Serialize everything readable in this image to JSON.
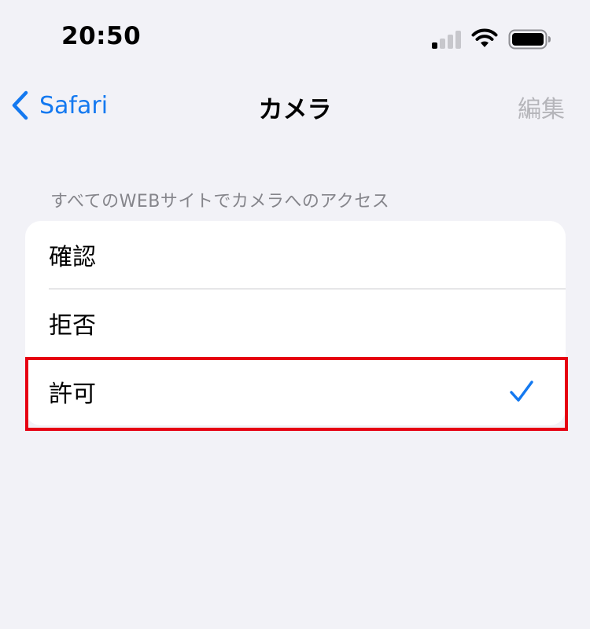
{
  "status_bar": {
    "time": "20:50"
  },
  "nav": {
    "back_label": "Safari",
    "title": "カメラ",
    "edit_label": "編集"
  },
  "section": {
    "header": "すべてのWEBサイトでカメラへのアクセス",
    "options": [
      {
        "label": "確認",
        "selected": false
      },
      {
        "label": "拒否",
        "selected": false
      },
      {
        "label": "許可",
        "selected": true
      }
    ]
  },
  "colors": {
    "accent": "#1479f0",
    "highlight": "#e60012",
    "background": "#f2f2f7"
  },
  "icons": {
    "signal": "cellular-signal-icon",
    "wifi": "wifi-icon",
    "battery": "battery-icon",
    "back": "chevron-left-icon",
    "check": "checkmark-icon"
  }
}
